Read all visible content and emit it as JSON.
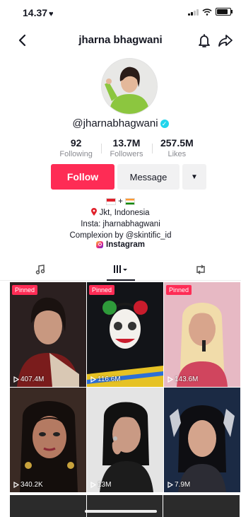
{
  "status_bar": {
    "time": "14.37",
    "heart": "♥"
  },
  "header": {
    "title": "jharna bhagwani"
  },
  "profile": {
    "username": "@jharnabhagwani",
    "verified_mark": "✓",
    "stats": [
      {
        "value": "92",
        "label": "Following"
      },
      {
        "value": "13.7M",
        "label": "Followers"
      },
      {
        "value": "257.5M",
        "label": "Likes"
      }
    ],
    "follow_label": "Follow",
    "message_label": "Message",
    "more_icon": "▼"
  },
  "bio": {
    "flags_separator": "+",
    "location": "Jkt, Indonesia",
    "insta": "Insta: jharnabhagwani",
    "complexion": "Complexion by @skintific_id",
    "link_label": "Instagram"
  },
  "tabs": [
    {
      "name": "music-note-icon",
      "active": false
    },
    {
      "name": "grid-icon",
      "active": true
    },
    {
      "name": "repost-icon",
      "active": false
    }
  ],
  "videos": [
    {
      "pinned": "Pinned",
      "views": "407.4M"
    },
    {
      "pinned": "Pinned",
      "views": "116.6M"
    },
    {
      "pinned": "Pinned",
      "views": "143.6M"
    },
    {
      "pinned": "",
      "views": "340.2K"
    },
    {
      "pinned": "",
      "views": "13M"
    },
    {
      "pinned": "",
      "views": "7.9M"
    }
  ],
  "colors": {
    "accent": "#fe2c55",
    "verified": "#20d5ec"
  }
}
